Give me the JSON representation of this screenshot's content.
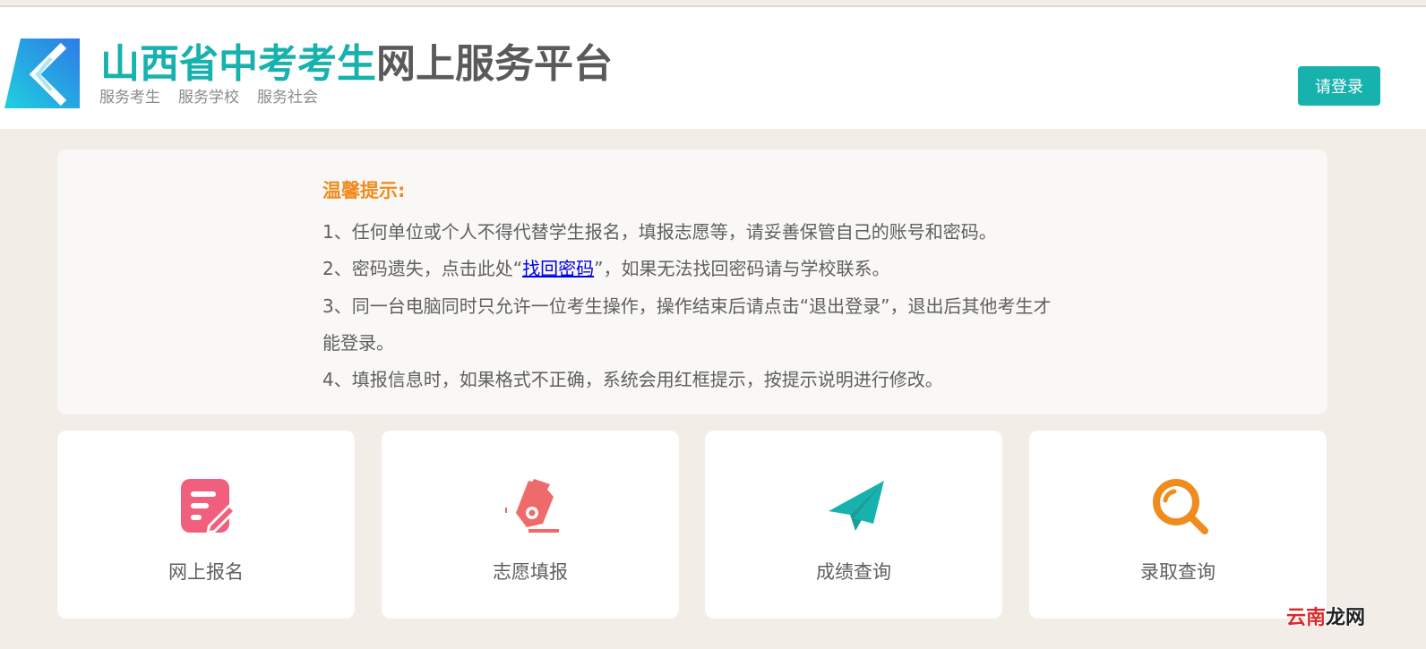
{
  "header": {
    "title_part1": "山西省中考考生",
    "title_part2": "网上服务平台",
    "taglines": [
      "服务考生",
      "服务学校",
      "服务社会"
    ],
    "login_label": "请登录"
  },
  "notice": {
    "title": "温馨提示:",
    "item1": "1、任何单位或个人不得代替学生报名，填报志愿等，请妥善保管自己的账号和密码。",
    "item2_before": "2、密码遗失，点击此处“",
    "item2_link": "找回密码",
    "item2_after": "”，如果无法找回密码请与学校联系。",
    "item3": "3、同一台电脑同时只允许一位考生操作，操作结束后请点击“退出登录”，退出后其他考生才能登录。",
    "item4": "4、填报信息时，如果格式不正确，系统会用红框提示，按提示说明进行修改。"
  },
  "cards": [
    {
      "label": "网上报名",
      "icon": "edit-note-icon",
      "color": "#f0607e"
    },
    {
      "label": "志愿填报",
      "icon": "pen-nib-icon",
      "color": "#ef6b6b"
    },
    {
      "label": "成绩查询",
      "icon": "paper-plane-icon",
      "color": "#17b2ad"
    },
    {
      "label": "录取查询",
      "icon": "magnifier-icon",
      "color": "#f08c1e"
    }
  ],
  "watermark": {
    "part1": "云南",
    "part2": "龙网"
  }
}
